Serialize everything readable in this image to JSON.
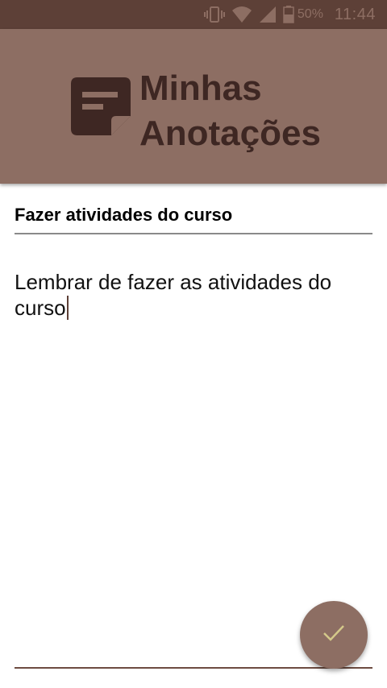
{
  "status_bar": {
    "icons": [
      "vibrate-icon",
      "wifi-icon",
      "signal-icon",
      "battery-icon"
    ],
    "battery": "50%",
    "time": "11:44"
  },
  "header": {
    "logo_icon": "note-icon",
    "title_line1": "Minhas",
    "title_line2": "Anotações"
  },
  "note": {
    "title_value": "Fazer atividades do curso",
    "body": "Lembrar de fazer as atividades do curso"
  },
  "fab": {
    "icon": "check-icon"
  },
  "colors": {
    "status_bar": "#5d4037",
    "header": "#8d6e63",
    "title_text": "#3e2723",
    "fab_check": "#d4c98a"
  }
}
